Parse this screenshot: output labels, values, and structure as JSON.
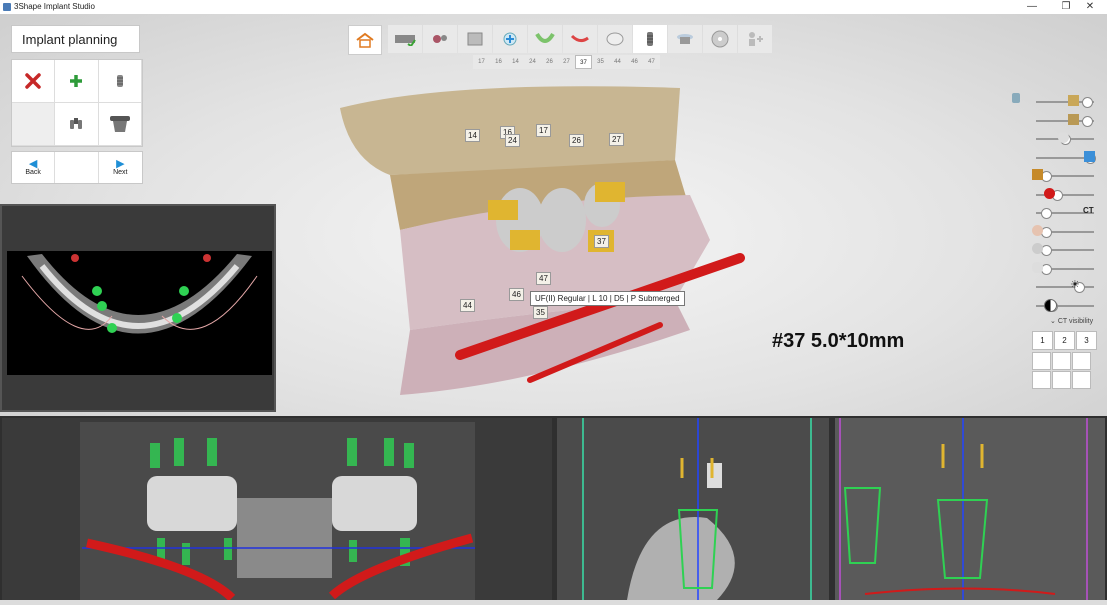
{
  "window": {
    "title": "3Shape Implant Studio",
    "controls": [
      "—",
      "❐",
      "✕"
    ]
  },
  "left_panel": {
    "title": "Implant planning",
    "tools": [
      {
        "name": "delete",
        "icon": "red-x-icon"
      },
      {
        "name": "add",
        "icon": "green-plus-icon"
      },
      {
        "name": "implant",
        "icon": "implant-icon"
      },
      {
        "name": "empty",
        "icon": ""
      },
      {
        "name": "multi-implant",
        "icon": "multi-implant-icon"
      },
      {
        "name": "abutment",
        "icon": "abutment-icon"
      }
    ],
    "nav": {
      "back": "Back",
      "next": "Next"
    }
  },
  "workflow_steps": [
    "scan-icon",
    "data-icon",
    "ct-icon",
    "implant-plan-icon",
    "gum-icon",
    "guide-icon",
    "crown-icon",
    "implant-icon",
    "sleeve-icon",
    "disc-icon",
    "person-icon"
  ],
  "active_step": 7,
  "tooth_tabs": [
    "17",
    "16",
    "14",
    "24",
    "26",
    "27",
    "37",
    "35",
    "44",
    "46",
    "47"
  ],
  "selected_tooth": "37",
  "tooth_tags": [
    {
      "label": "14"
    },
    {
      "label": "16"
    },
    {
      "label": "24"
    },
    {
      "label": "17"
    },
    {
      "label": "26"
    },
    {
      "label": "27"
    },
    {
      "label": "37"
    },
    {
      "label": "47"
    },
    {
      "label": "46"
    },
    {
      "label": "44"
    },
    {
      "label": "35"
    }
  ],
  "tooltip": "UF(II) Regular | L 10 | D5 | P Submerged",
  "implant_label": "#37 5.0*10mm",
  "right_controls": {
    "ct_label": "CT",
    "ct_visibility": "CT visibility",
    "view_numbers": [
      "1",
      "2",
      "3"
    ],
    "slider_levels": [
      0.85,
      0.85,
      0.45,
      0.9,
      0.1,
      0.3,
      0.1,
      0.1,
      0.1,
      0.1,
      0.7,
      0.2
    ]
  },
  "colors": {
    "accent_blue": "#1f8fd6",
    "plus_green": "#2e9b3a",
    "delete_red": "#c62828",
    "nerve_red": "#d11a1a",
    "implant_green": "#2fd153",
    "implant_gold": "#e0b530"
  }
}
